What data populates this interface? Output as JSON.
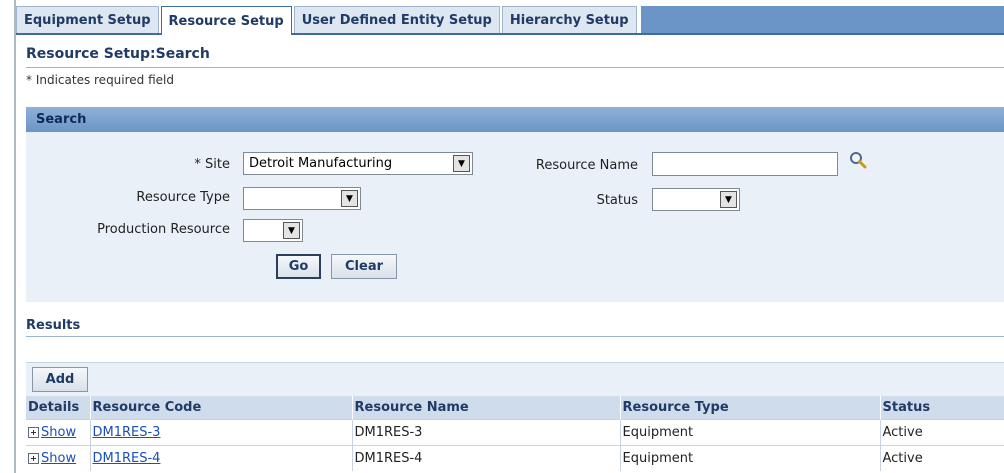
{
  "tabs": [
    {
      "label": "Equipment Setup"
    },
    {
      "label": "Resource Setup"
    },
    {
      "label": "User Defined Entity Setup"
    },
    {
      "label": "Hierarchy Setup"
    }
  ],
  "page": {
    "title": "Resource Setup:Search",
    "required_note": "* Indicates required field"
  },
  "search": {
    "header": "Search",
    "site_label": "* Site",
    "site_value": "Detroit Manufacturing",
    "resource_type_label": "Resource Type",
    "resource_type_value": "",
    "production_resource_label": "Production Resource",
    "production_resource_value": "",
    "resource_name_label": "Resource Name",
    "resource_name_value": "",
    "status_label": "Status",
    "status_value": "",
    "go_label": "Go",
    "clear_label": "Clear"
  },
  "results": {
    "title": "Results",
    "add_label": "Add",
    "columns": [
      "Details",
      "Resource Code",
      "Resource Name",
      "Resource Type",
      "Status"
    ],
    "rows": [
      {
        "details": "Show",
        "code": "DM1RES-3",
        "name": "DM1RES-3",
        "type": "Equipment",
        "status": "Active"
      },
      {
        "details": "Show",
        "code": "DM1RES-4",
        "name": "DM1RES-4",
        "type": "Equipment",
        "status": "Active"
      }
    ]
  },
  "colors": {
    "tab_active_border": "#3f6ba5",
    "header_blue": "#6b95c6",
    "link": "#1b4fb8",
    "panel_bg": "#eaf0f7"
  },
  "icons": {
    "search": "search-icon",
    "expand": "plus-icon",
    "dropdown": "chevron-down-icon"
  }
}
